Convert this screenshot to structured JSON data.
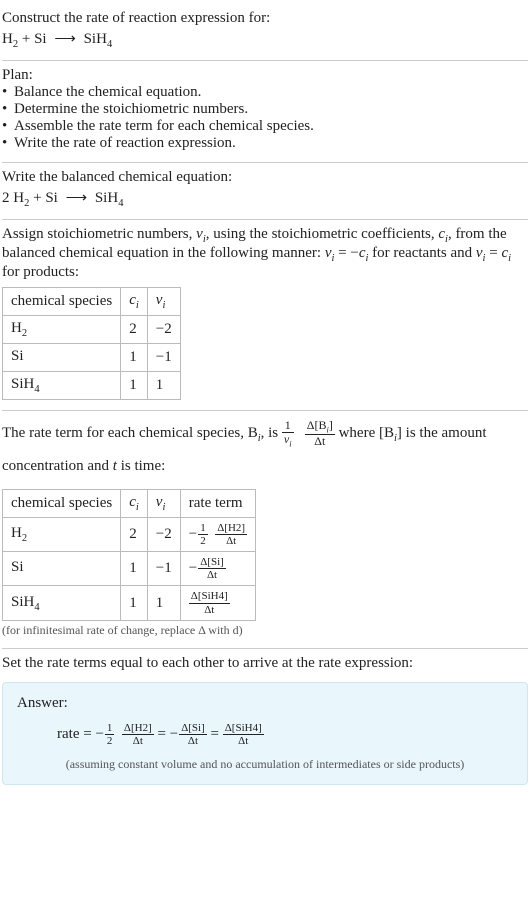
{
  "intro": {
    "prompt": "Construct the rate of reaction expression for:",
    "eq_lhs_a": "H",
    "eq_lhs_a_sub": "2",
    "plus1": " + ",
    "eq_lhs_b": "Si",
    "arrow": "⟶",
    "eq_rhs_a": "SiH",
    "eq_rhs_a_sub": "4"
  },
  "plan": {
    "heading": "Plan:",
    "items": [
      "Balance the chemical equation.",
      "Determine the stoichiometric numbers.",
      "Assemble the rate term for each chemical species.",
      "Write the rate of reaction expression."
    ]
  },
  "balanced": {
    "heading": "Write the balanced chemical equation:",
    "coef1": "2 ",
    "sp1": "H",
    "sp1_sub": "2",
    "plus": " + ",
    "sp2": "Si",
    "arrow": "⟶",
    "sp3": "SiH",
    "sp3_sub": "4"
  },
  "assign": {
    "text1": "Assign stoichiometric numbers, ",
    "nu_i": "ν",
    "i1": "i",
    "text2": ", using the stoichiometric coefficients, ",
    "c_i": "c",
    "i2": "i",
    "text3": ", from the balanced chemical equation in the following manner: ",
    "rel_reactants_l": "ν",
    "rel_reactants_li": "i",
    "eq": " = −",
    "rel_reactants_r": "c",
    "rel_reactants_ri": "i",
    "text4": " for reactants and ",
    "rel_products_l": "ν",
    "rel_products_li": "i",
    "eq2": " = ",
    "rel_products_r": "c",
    "rel_products_ri": "i",
    "text5": " for products:",
    "headers": {
      "species": "chemical species",
      "ci": "c",
      "ci_i": "i",
      "nui": "ν",
      "nui_i": "i"
    },
    "rows": [
      {
        "name": "H",
        "sub": "2",
        "ci": "2",
        "nui": "−2"
      },
      {
        "name": "Si",
        "sub": "",
        "ci": "1",
        "nui": "−1"
      },
      {
        "name": "SiH",
        "sub": "4",
        "ci": "1",
        "nui": "1"
      }
    ]
  },
  "rateterm": {
    "text1": "The rate term for each chemical species, B",
    "Bi_i": "i",
    "text2": ", is ",
    "one": "1",
    "nu": "ν",
    "nu_i": "i",
    "dBi_num_a": "Δ[B",
    "dBi_num_i": "i",
    "dBi_num_b": "]",
    "dBi_den": "Δt",
    "text3": " where [B",
    "text3_i": "i",
    "text4": "] is the amount concentration and ",
    "t": "t",
    "text5": " is time:",
    "headers": {
      "species": "chemical species",
      "ci": "c",
      "ci_i": "i",
      "nui": "ν",
      "nui_i": "i",
      "rate": "rate term"
    },
    "rows": [
      {
        "name": "H",
        "sub": "2",
        "ci": "2",
        "nui": "−2",
        "neg": "−",
        "half_num": "1",
        "half_den": "2",
        "dnum": "Δ[H2]",
        "dden": "Δt"
      },
      {
        "name": "Si",
        "sub": "",
        "ci": "1",
        "nui": "−1",
        "neg": "−",
        "half_num": "",
        "half_den": "",
        "dnum": "Δ[Si]",
        "dden": "Δt"
      },
      {
        "name": "SiH",
        "sub": "4",
        "ci": "1",
        "nui": "1",
        "neg": "",
        "half_num": "",
        "half_den": "",
        "dnum": "Δ[SiH4]",
        "dden": "Δt"
      }
    ],
    "note": "(for infinitesimal rate of change, replace Δ with d)"
  },
  "final": {
    "heading": "Set the rate terms equal to each other to arrive at the rate expression:",
    "answer_label": "Answer:",
    "rate_label": "rate = ",
    "neg": "−",
    "half_num": "1",
    "half_den": "2",
    "t1_num": "Δ[H2]",
    "t1_den": "Δt",
    "eq1": " = ",
    "t2_num": "Δ[Si]",
    "t2_den": "Δt",
    "eq2": " = ",
    "t3_num": "Δ[SiH4]",
    "t3_den": "Δt",
    "assumption": "(assuming constant volume and no accumulation of intermediates or side products)"
  },
  "chart_data": {
    "type": "table",
    "tables": [
      {
        "title": "Stoichiometric numbers",
        "columns": [
          "chemical species",
          "c_i",
          "ν_i"
        ],
        "rows": [
          [
            "H2",
            2,
            -2
          ],
          [
            "Si",
            1,
            -1
          ],
          [
            "SiH4",
            1,
            1
          ]
        ]
      },
      {
        "title": "Rate terms",
        "columns": [
          "chemical species",
          "c_i",
          "ν_i",
          "rate term"
        ],
        "rows": [
          [
            "H2",
            2,
            -2,
            "-(1/2) Δ[H2]/Δt"
          ],
          [
            "Si",
            1,
            -1,
            "-Δ[Si]/Δt"
          ],
          [
            "SiH4",
            1,
            1,
            "Δ[SiH4]/Δt"
          ]
        ]
      }
    ],
    "final_expression": "rate = -(1/2) Δ[H2]/Δt = -Δ[Si]/Δt = Δ[SiH4]/Δt"
  }
}
